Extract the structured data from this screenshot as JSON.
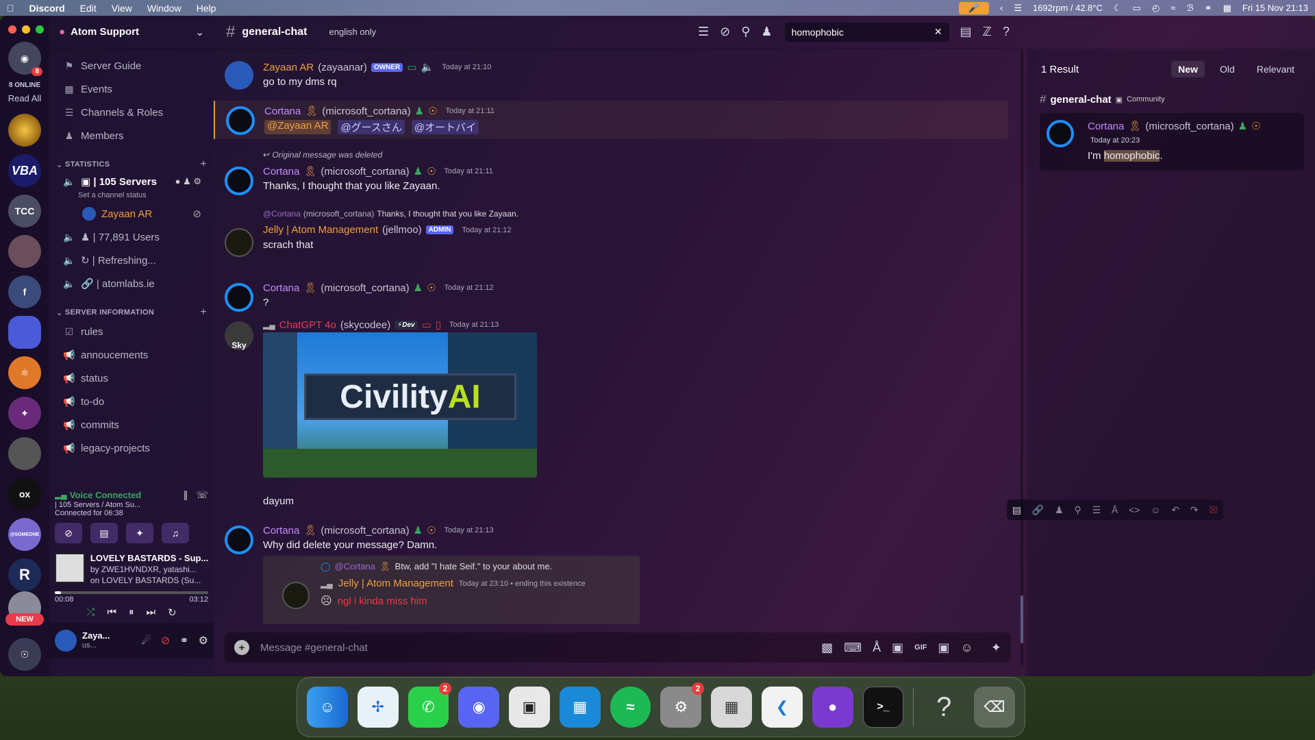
{
  "menubar": {
    "app": "Discord",
    "items": [
      "Edit",
      "View",
      "Window",
      "Help"
    ],
    "fan": "1692rpm / 42.8°C",
    "clock": "Fri 15 Nov  21:13"
  },
  "guilds": {
    "online": "8 ONLINE",
    "read_all": "Read All",
    "badge": "8",
    "tcc": "TCC",
    "f": "f",
    "new": "NEW",
    "someone": "@SOMEONE",
    "r": "R"
  },
  "sidebar": {
    "server_name": "Atom Support",
    "top_items": [
      "Server Guide",
      "Events",
      "Channels & Roles",
      "Members"
    ],
    "cat_stats": "STATISTICS",
    "stat_servers": "| 105 Servers",
    "stat_status": "Set a channel status",
    "stat_user": "Zayaan AR",
    "stat_users": "| 77,891 Users",
    "stat_refresh": "| Refreshing...",
    "stat_site": "| atomlabs.ie",
    "cat_info": "SERVER INFORMATION",
    "info_items": [
      "rules",
      "annoucements",
      "status",
      "to-do",
      "commits",
      "legacy-projects"
    ],
    "voice_title": "Voice Connected",
    "voice_channel": "| 105 Servers / Atom Su...",
    "voice_time": "Connected for 06:38",
    "song_title": "LOVELY BASTARDS - Sup...",
    "song_artist": "by ZWE1HVNDXR, yatashi...",
    "song_album": "on LOVELY BASTARDS (Su...",
    "song_elapsed": "00:08",
    "song_total": "03:12",
    "song_progress": 0.04,
    "user_name": "Zaya...",
    "user_status": "us..."
  },
  "chat": {
    "channel": "general-chat",
    "topic": "english only",
    "search_value": "homophobic",
    "input_placeholder": "Message #general-chat",
    "m1": {
      "user": "Zayaan AR",
      "handle": "(zayaanar)",
      "tag": "OWNER",
      "time": "Today at 21:10",
      "text": "go to my dms rq"
    },
    "m2": {
      "user": "Cortana",
      "handle": "(microsoft_cortana)",
      "time": "Today at 21:11",
      "mention1": "@Zayaan AR",
      "mention2": "@グースさん",
      "mention3": "@オートバイ"
    },
    "m3": {
      "reply": "Original message was deleted",
      "user": "Cortana",
      "handle": "(microsoft_cortana)",
      "time": "Today at 21:11",
      "text": "Thanks, I thought that you like Zayaan."
    },
    "m4": {
      "reply_user": "@Cortana",
      "reply_handle": "(microsoft_cortana)",
      "reply_text": "Thanks, I thought that you like Zayaan.",
      "user": "Jelly | Atom Management",
      "handle": "(jellmoo)",
      "tag": "ADMIN",
      "time": "Today at 21:12",
      "text": "scrach that"
    },
    "m5": {
      "user": "Cortana",
      "handle": "(microsoft_cortana)",
      "time": "Today at 21:12",
      "text": "?"
    },
    "m6": {
      "user": "ChatGPT 4o",
      "handle": "(skycodee)",
      "tag": "Dev",
      "time": "Today at 21:13",
      "image_text": "CivilityAI",
      "image_text_a": "Civility",
      "image_text_b": "AI",
      "text": "dayum",
      "avatar": "Sky"
    },
    "m7": {
      "user": "Cortana",
      "handle": "(microsoft_cortana)",
      "time": "Today at 21:13",
      "text": "Why did delete your message? Damn.",
      "embed": {
        "reply_user": "@Cortana",
        "reply_text": "Btw, add \"I hate Seif.\" to your about me.",
        "user": "Jelly | Atom Management",
        "time": "Today at 23:10 • ending this existence",
        "text": "ngl i kinda miss him"
      }
    }
  },
  "search_panel": {
    "results": "1 Result",
    "tabs": [
      "New",
      "Old",
      "Relevant"
    ],
    "channel": "general-chat",
    "category": "Community",
    "user": "Cortana",
    "handle": "(microsoft_cortana)",
    "time": "Today at 20:23",
    "text_a": "I'm ",
    "highlight": "homophobic",
    "text_b": "."
  },
  "dock": {
    "badge_whatsapp": "2",
    "badge_settings": "2"
  }
}
